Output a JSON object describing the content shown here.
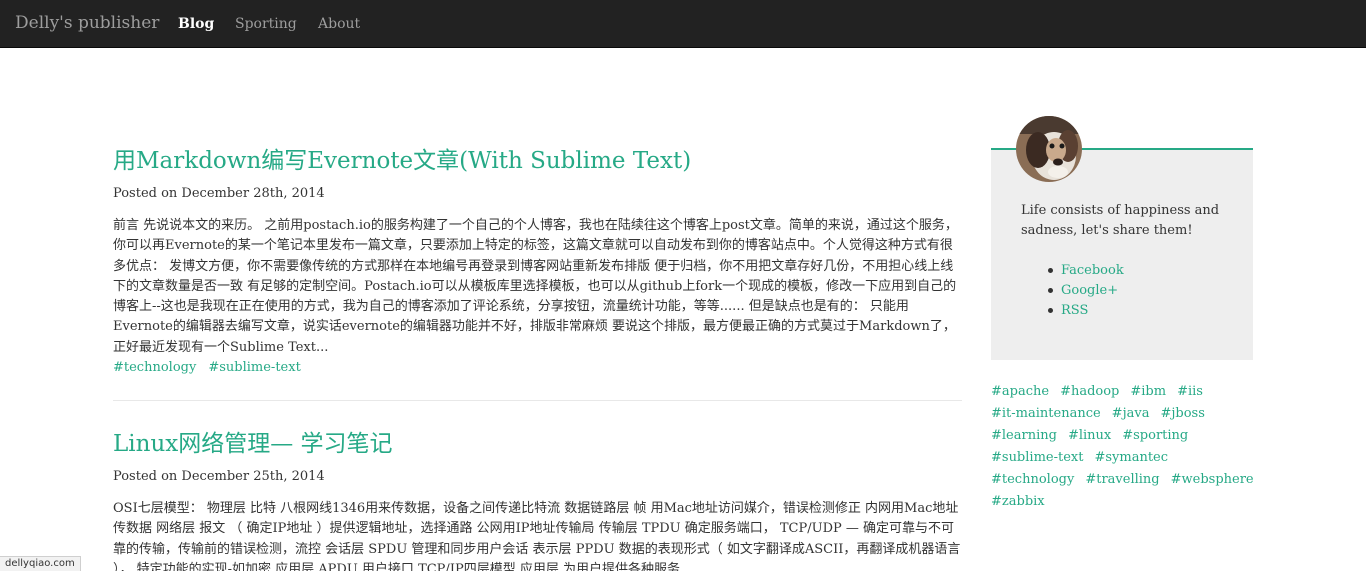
{
  "nav": {
    "brand": "Delly's publisher",
    "links": [
      "Blog",
      "Sporting",
      "About"
    ]
  },
  "posts": [
    {
      "title": "用Markdown编写Evernote文章(With Sublime Text)",
      "meta": "Posted on December 28th, 2014",
      "excerpt": "前言 先说说本文的来历。 之前用postach.io的服务构建了一个自己的个人博客，我也在陆续往这个博客上post文章。简单的来说，通过这个服务，你可以再Evernote的某一个笔记本里发布一篇文章，只要添加上特定的标签，这篇文章就可以自动发布到你的博客站点中。个人觉得这种方式有很多优点： 发博文方便，你不需要像传统的方式那样在本地编号再登录到博客网站重新发布排版 便于归档，你不用把文章存好几份，不用担心线上线下的文章数量是否一致 有足够的定制空间。Postach.io可以从模板库里选择模板，也可以从github上fork一个现成的模板，修改一下应用到自己的博客上--这也是我现在正在使用的方式，我为自己的博客添加了评论系统，分享按钮，流量统计功能，等等...... 但是缺点也是有的： 只能用Evernote的编辑器去编写文章，说实话evernote的编辑器功能并不好，排版非常麻烦 要说这个排版，最方便最正确的方式莫过于Markdown了，正好最近发现有一个Sublime Text...",
      "tags": [
        "#technology",
        "#sublime-text"
      ]
    },
    {
      "title": "Linux网络管理— 学习笔记",
      "meta": "Posted on December 25th, 2014",
      "excerpt": "OSI七层模型： 物理层 比特 八根网线1346用来传数据，设备之间传递比特流 数据链路层 帧 用Mac地址访问媒介，错误检测修正 内网用Mac地址传数据 网络层 报文 （ 确定IP地址 ）提供逻辑地址，选择通路 公网用IP地址传输局 传输层 TPDU 确定服务端口， TCP/UDP — 确定可靠与不可靠的传输，传输前的错误检测，流控 会话层 SPDU 管理和同步用户会话 表示层 PPDU 数据的表现形式（ 如文字翻译成ASCII，再翻译成机器语言 ）， 特定功能的实现-如加密 应用层 APDU 用户接口 TCP/IP四层模型 应用层 为用户提供各种服务"
    }
  ],
  "sidebar": {
    "bio": "Life consists of happiness and sadness, let's share them!",
    "social_links": [
      "Facebook",
      "Google+",
      "RSS"
    ],
    "tags": [
      [
        "#apache",
        "#hadoop",
        "#ibm",
        "#iis"
      ],
      [
        "#it-maintenance",
        "#java",
        "#jboss"
      ],
      [
        "#learning",
        "#linux",
        "#sporting"
      ],
      [
        "#sublime-text",
        "#symantec"
      ],
      [
        "#technology",
        "#travelling",
        "#websphere"
      ],
      [
        "#zabbix"
      ]
    ]
  },
  "status_url": "dellyqiao.com",
  "colors": {
    "accent": "#26a986",
    "navbar": "#222222",
    "card": "#eeeeee"
  }
}
